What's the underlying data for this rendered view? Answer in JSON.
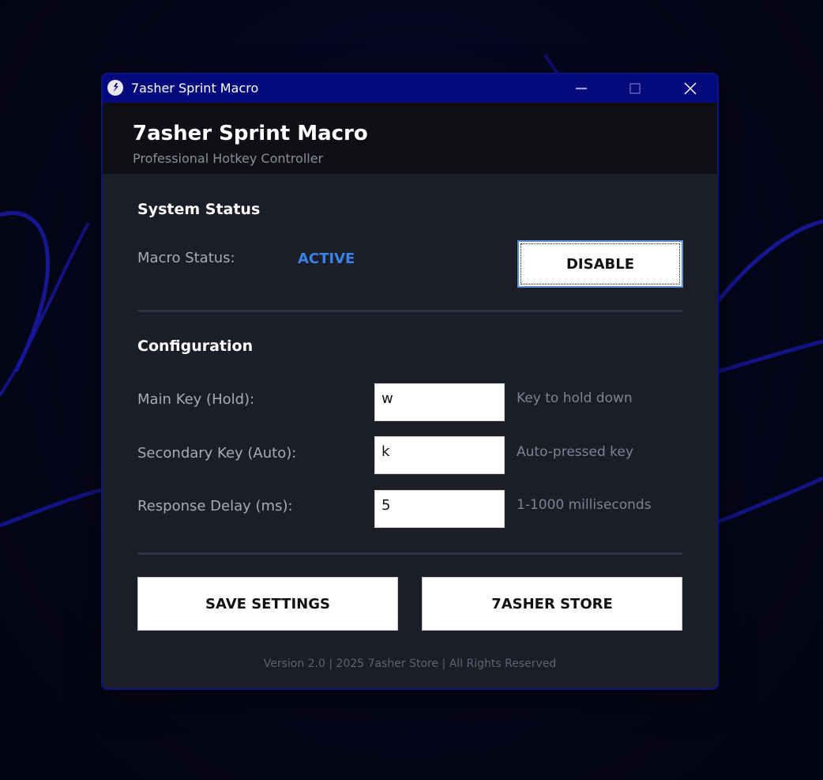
{
  "window": {
    "title": "7asher Sprint Macro",
    "controls": {
      "minimize": "minimize",
      "maximize": "maximize",
      "close": "close"
    }
  },
  "header": {
    "title": "7asher Sprint Macro",
    "subtitle": "Professional Hotkey Controller"
  },
  "system_status": {
    "title": "System Status",
    "macro_status_label": "Macro Status:",
    "macro_status_value": "ACTIVE",
    "toggle_label": "DISABLE"
  },
  "configuration": {
    "title": "Configuration",
    "fields": [
      {
        "label": "Main Key (Hold):",
        "value": "w",
        "hint": "Key to hold down"
      },
      {
        "label": "Secondary Key (Auto):",
        "value": "k",
        "hint": "Auto-pressed key"
      },
      {
        "label": "Response Delay (ms):",
        "value": "5",
        "hint": "1-1000 milliseconds"
      }
    ]
  },
  "actions": {
    "save_label": "SAVE SETTINGS",
    "store_label": "7ASHER STORE"
  },
  "footer": {
    "text": "Version 2.0 |  2025 7asher Store | All Rights Reserved"
  },
  "colors": {
    "titlebar": "#040a7e",
    "window_bg": "#1b1d28",
    "status_active": "#3b82e6",
    "accent_border": "#0b1487"
  },
  "icons": {
    "app": "sprint-runner-icon",
    "minimize": "minimize-icon",
    "maximize": "maximize-icon",
    "close": "close-icon"
  }
}
